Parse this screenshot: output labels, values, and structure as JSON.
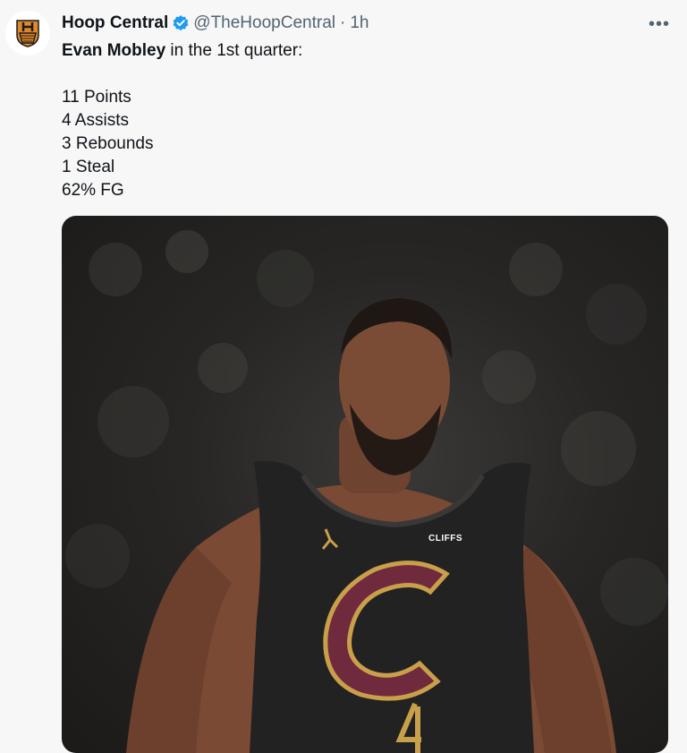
{
  "tweet": {
    "author_name": "Hoop Central",
    "handle": "@TheHoopCentral",
    "separator": "·",
    "time": "1h",
    "more_label": "•••",
    "text": {
      "bold_name": "Evan Mobley",
      "intro_rest": " in the 1st quarter:",
      "stats": [
        "11 Points",
        "4 Assists",
        "3 Rebounds",
        "1 Steal",
        "62% FG"
      ]
    },
    "image": {
      "jersey_patch_text": "CLIFFS",
      "jersey_number": "4"
    }
  },
  "icons": {
    "avatar": "hoop-central-logo-icon",
    "verified": "verified-badge-icon",
    "more": "more-options-icon"
  },
  "colors": {
    "verified_blue": "#1d9bf0",
    "secondary_text": "#536471",
    "wine": "#6f2a3e",
    "gold": "#c9a04a"
  }
}
